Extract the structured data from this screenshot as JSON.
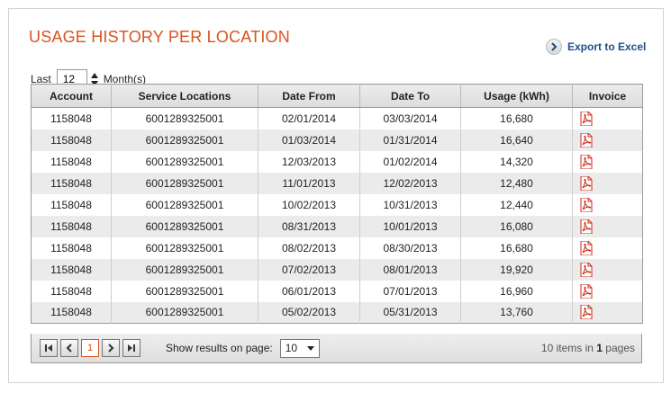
{
  "title": "USAGE HISTORY PER LOCATION",
  "export": {
    "label": "Export to Excel",
    "icon": "chevron-right-icon"
  },
  "filter": {
    "prefix": "Last",
    "value": "12",
    "suffix": "Month(s)"
  },
  "table": {
    "columns": [
      "Account",
      "Service Locations",
      "Date From",
      "Date To",
      "Usage (kWh)",
      "Invoice"
    ],
    "rows": [
      [
        "1158048",
        "6001289325001",
        "02/01/2014",
        "03/03/2014",
        "16,680"
      ],
      [
        "1158048",
        "6001289325001",
        "01/03/2014",
        "01/31/2014",
        "16,640"
      ],
      [
        "1158048",
        "6001289325001",
        "12/03/2013",
        "01/02/2014",
        "14,320"
      ],
      [
        "1158048",
        "6001289325001",
        "11/01/2013",
        "12/02/2013",
        "12,480"
      ],
      [
        "1158048",
        "6001289325001",
        "10/02/2013",
        "10/31/2013",
        "12,440"
      ],
      [
        "1158048",
        "6001289325001",
        "08/31/2013",
        "10/01/2013",
        "16,080"
      ],
      [
        "1158048",
        "6001289325001",
        "08/02/2013",
        "08/30/2013",
        "16,680"
      ],
      [
        "1158048",
        "6001289325001",
        "07/02/2013",
        "08/01/2013",
        "19,920"
      ],
      [
        "1158048",
        "6001289325001",
        "06/01/2013",
        "07/01/2013",
        "16,960"
      ],
      [
        "1158048",
        "6001289325001",
        "05/02/2013",
        "05/31/2013",
        "13,760"
      ]
    ],
    "invoice_icon": "pdf-icon"
  },
  "pager": {
    "current_page": "1",
    "show_label": "Show results on page:",
    "page_size": "10",
    "items": "10",
    "items_text": " items in ",
    "pages": "1",
    "pages_text": " pages"
  },
  "colors": {
    "accent": "#d9531e",
    "link": "#1d4f8a",
    "pdf": "#cc2a1a"
  }
}
